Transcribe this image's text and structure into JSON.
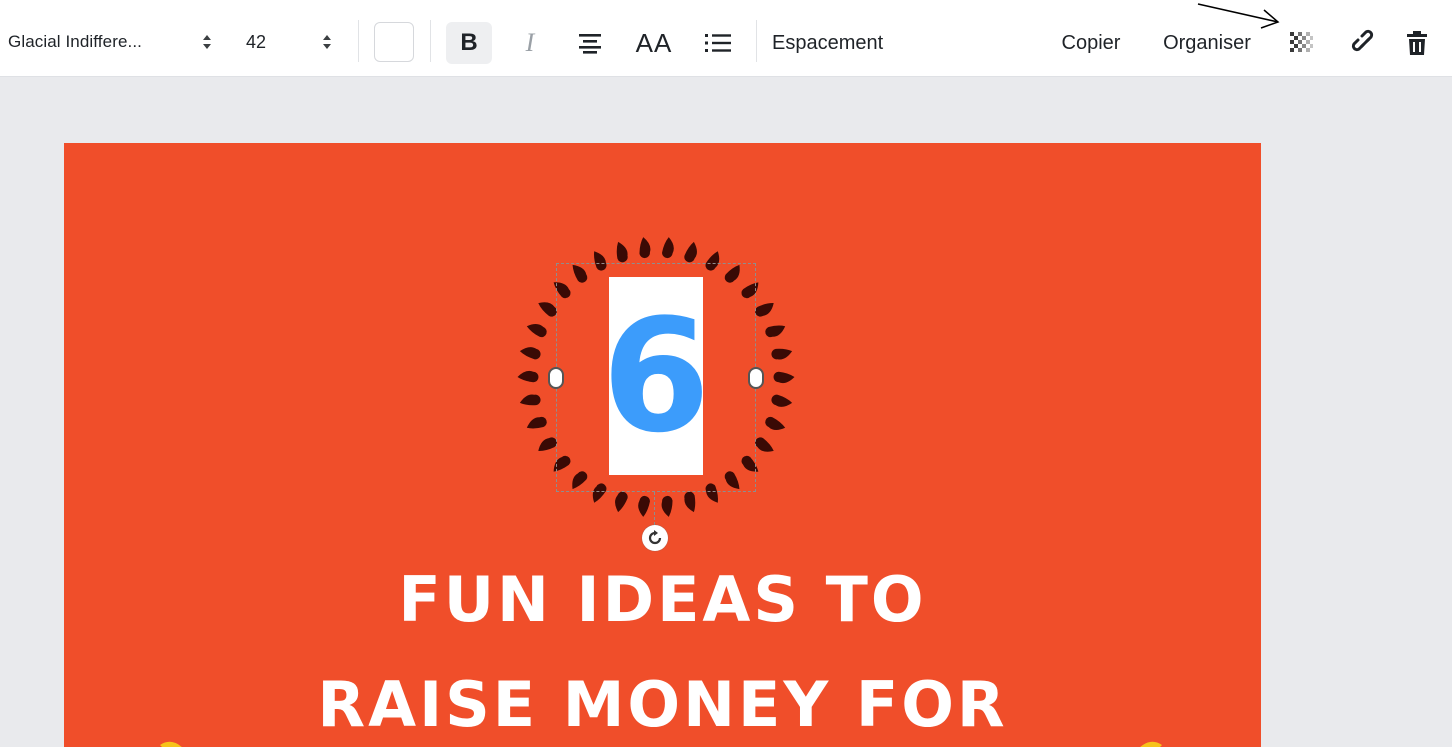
{
  "toolbar": {
    "font_name": "Glacial Indiffere...",
    "font_size": "42",
    "bold_label": "B",
    "italic_label": "I",
    "case_label": "AA",
    "spacing_label": "Espacement",
    "copy_label": "Copier",
    "arrange_label": "Organiser",
    "text_color": "#ffffff"
  },
  "canvas": {
    "background": "#f04e2a",
    "number": "6",
    "number_color": "#3c9cfb",
    "headline_line1": "FUN IDEAS TO",
    "headline_line2": "RAISE MONEY FOR"
  },
  "icons": {
    "font_stepper": "updown-arrows-icon",
    "size_stepper": "updown-arrows-icon",
    "align": "align-center-icon",
    "list": "bulleted-list-icon",
    "transparency": "transparency-checker-icon",
    "link": "link-icon",
    "trash": "trash-icon",
    "rotate": "rotate-icon"
  }
}
